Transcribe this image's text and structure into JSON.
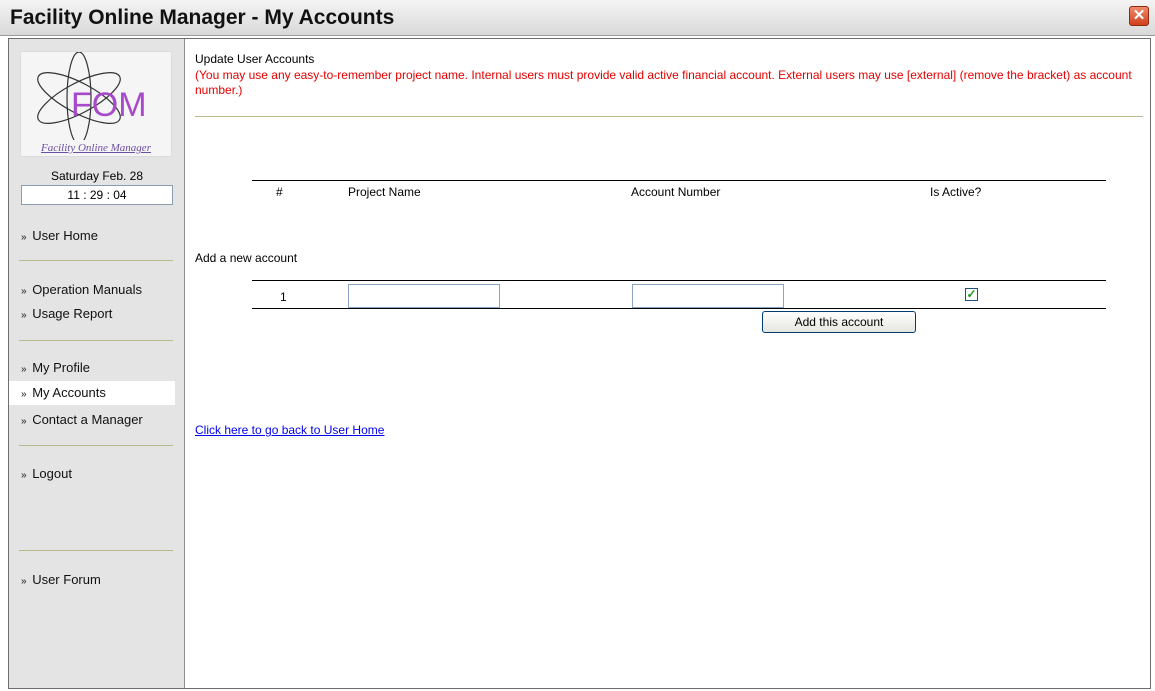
{
  "window": {
    "title": "Facility Online Manager - My Accounts"
  },
  "sidebar": {
    "logo_text": "FOM",
    "logo_caption": "Facility Online Manager",
    "date": "Saturday Feb. 28",
    "clock": "11 : 29 : 04",
    "nav_prefix": "»",
    "items": [
      {
        "label": "User Home"
      },
      {
        "label": "Operation Manuals"
      },
      {
        "label": "Usage Report"
      },
      {
        "label": "My Profile"
      },
      {
        "label": "My Accounts",
        "active": true
      },
      {
        "label": "Contact a Manager"
      },
      {
        "label": "Logout"
      },
      {
        "label": "User Forum"
      }
    ]
  },
  "main": {
    "heading": "Update User Accounts",
    "note": "(You may use any easy-to-remember project name. Internal users must provide valid active financial account. External users may use [external] (remove the bracket) as account number.)",
    "table": {
      "headers": [
        "#",
        "Project Name",
        "Account Number",
        "Is Active?"
      ]
    },
    "add_section": {
      "label": "Add a new account",
      "row_number": "1",
      "project_name_value": "",
      "account_number_value": "",
      "is_active_checked": true,
      "button_label": "Add this account"
    },
    "back_link": "Click here to go back to User Home"
  },
  "colors": {
    "note_red": "#e40000",
    "link_blue": "#0000ee",
    "sidebar_bg": "#e4e4e4",
    "logo_purple": "#a64ac9"
  }
}
